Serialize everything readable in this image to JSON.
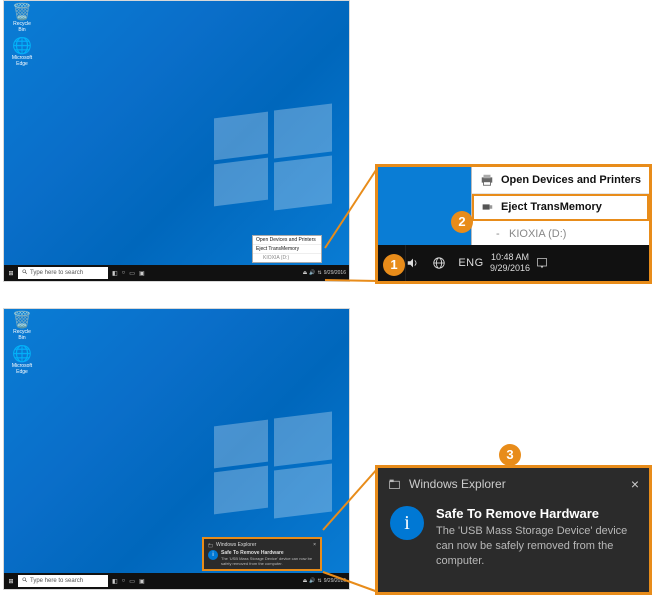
{
  "accent": "#e88c1a",
  "desktop": {
    "recycle_label": "Recycle Bin",
    "edge_label": "Microsoft Edge",
    "search_placeholder": "Type here to search",
    "tray_date": "9/29/2016"
  },
  "eject_menu": {
    "open_devices": "Open Devices and Printers",
    "eject_label": "Eject TransMemory",
    "drive_label": "KIOXIA (D:)"
  },
  "tray_detail": {
    "lang": "ENG",
    "time": "10:48 AM",
    "date": "9/29/2016"
  },
  "toast": {
    "app": "Windows Explorer",
    "title": "Safe To Remove Hardware",
    "message": "The 'USB Mass Storage Device' device can now be safely removed from the computer."
  },
  "steps": {
    "s1": "1",
    "s2": "2",
    "s3": "3"
  }
}
